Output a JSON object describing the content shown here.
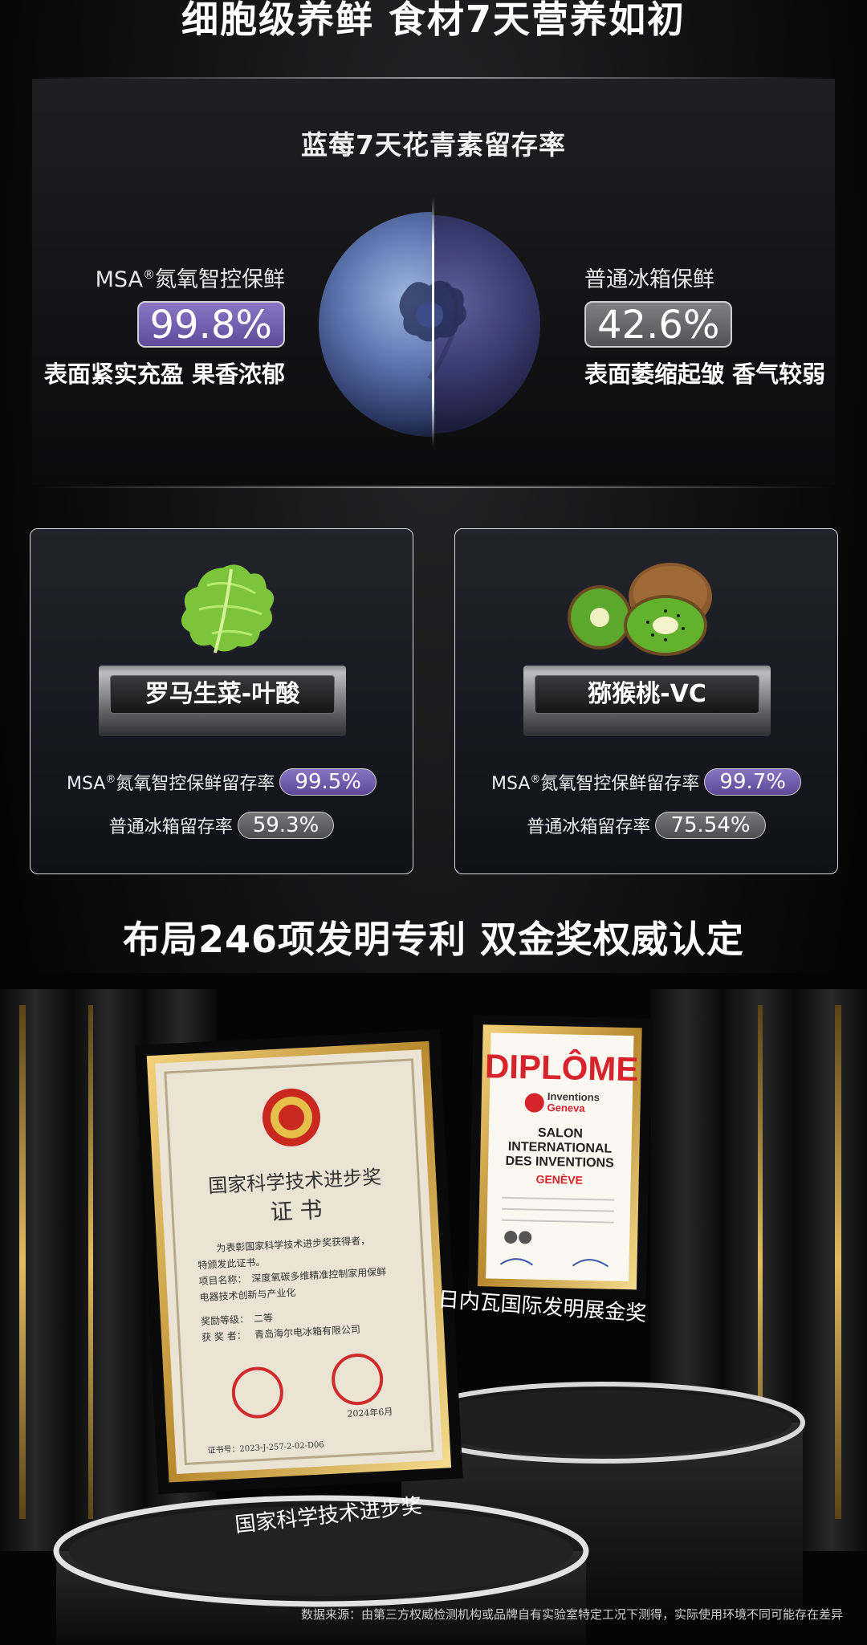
{
  "headline": "细胞级养鲜 食材7天营养如初",
  "blueberry_section": {
    "title": "蓝莓7天花青素留存率",
    "left": {
      "label_prefix": "MSA",
      "label_mark": "®",
      "label_suffix": "氮氧智控保鲜",
      "value": "99.8%",
      "desc": "表面紧实充盈 果香浓郁"
    },
    "right": {
      "label": "普通冰箱保鲜",
      "value": "42.6%",
      "desc": "表面萎缩起皱 香气较弱"
    }
  },
  "cards": [
    {
      "title": "罗马生菜-叶酸",
      "msa_prefix": "MSA",
      "msa_mark": "®",
      "msa_label": "氮氧智控保鲜留存率",
      "msa_value": "99.5%",
      "normal_label": "普通冰箱留存率",
      "normal_value": "59.3%"
    },
    {
      "title": "猕猴桃-VC",
      "msa_prefix": "MSA",
      "msa_mark": "®",
      "msa_label": "氮氧智控保鲜留存率",
      "msa_value": "99.7%",
      "normal_label": "普通冰箱留存率",
      "normal_value": "75.54%"
    }
  ],
  "awards_headline": "布局246项发明专利 双金奖权威认定",
  "awards": {
    "national": {
      "title_line1": "国家科学技术进步奖",
      "title_line2": "证 书",
      "body1": "为表彰国家科学技术进步奖获得者，",
      "body2": "特颁发此证书。",
      "project_label": "项目名称：",
      "project_line1": "深度氧碳多维精准控制家用保鲜",
      "project_line2": "电器技术创新与产业化",
      "grade_label": "奖励等级：",
      "grade": "二等",
      "winner_label": "获 奖 者：",
      "winner": "青岛海尔电冰箱有限公司",
      "date": "2024年6月",
      "cert_no": "证书号：2023-J-257-2-02-D06",
      "caption": "国家科学技术进步奖"
    },
    "geneva": {
      "diplome": "DIPLÔME",
      "brand_top": "Inventions",
      "brand_bottom": "Geneva",
      "salon1": "SALON",
      "salon2": "INTERNATIONAL",
      "salon3": "DES INVENTIONS",
      "city": "GENÈVE",
      "caption": "日内瓦国际发明展金奖"
    }
  },
  "source_note": "数据来源：由第三方权威检测机构或品牌自有实验室特定工况下测得，实际使用环境不同可能存在差异",
  "colors": {
    "msa_purple": "#6f5bb0",
    "normal_grey": "#616164",
    "gold": "#d9b45a",
    "diplome_red": "#d7232c"
  }
}
